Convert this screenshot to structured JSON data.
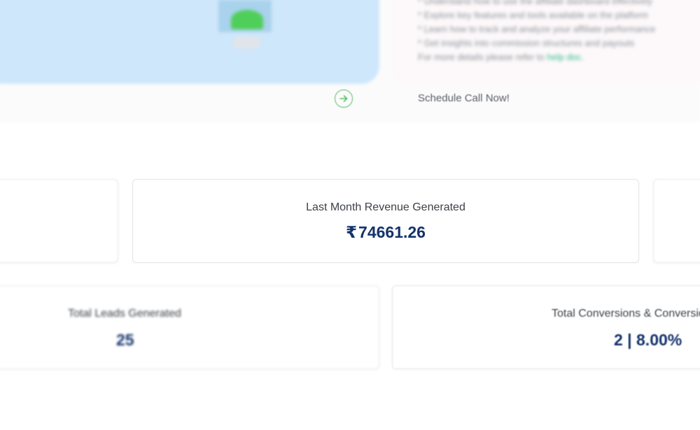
{
  "intro": {
    "bullets": [
      "* Understand how to use the affiliate dashboard effectively",
      "* Explore key features and tools available on the platform",
      "* Learn how to track and analyze your affiliate performance",
      "* Get insights into commission structures and payouts"
    ],
    "details_prefix": "For more details please refer to ",
    "help_link": "help doc."
  },
  "schedule_call_label": "Schedule Call Now!",
  "stats": {
    "last_month_revenue": {
      "title": "Last Month Revenue Generated",
      "currency": "₹",
      "value": "74661.26"
    },
    "total_leads": {
      "title": "Total Leads Generated",
      "value": "25"
    },
    "total_conversions": {
      "title": "Total Conversions & Conversion Rate",
      "value": "2 | 8.00%"
    }
  },
  "colors": {
    "hero_background": "#cfe7fb",
    "accent_green": "#57c066",
    "link_green": "#2eb88a",
    "value_navy": "#14326b"
  },
  "icons": {
    "arrow_button": "arrow-right-circle-icon"
  }
}
